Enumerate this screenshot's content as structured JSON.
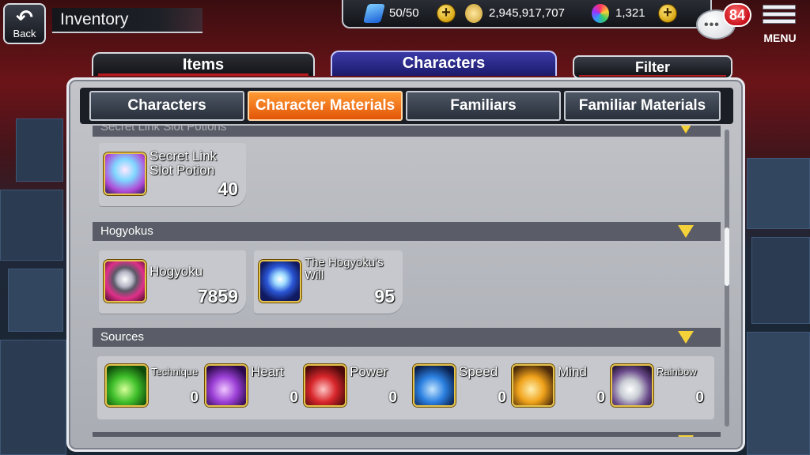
{
  "header": {
    "back_label": "Back",
    "title": "Inventory"
  },
  "resources": {
    "stamina": "50/50",
    "coins": "2,945,917,707",
    "orbs": "1,321"
  },
  "notifications": {
    "count": "84"
  },
  "menu": {
    "label": "MENU"
  },
  "top_tabs": [
    {
      "label": "Items"
    },
    {
      "label": "Characters",
      "active": true
    }
  ],
  "filter": {
    "label": "Filter"
  },
  "sub_tabs": [
    {
      "label": "Characters"
    },
    {
      "label": "Character Materials",
      "active": true
    },
    {
      "label": "Familiars"
    },
    {
      "label": "Familiar Materials"
    }
  ],
  "sections": {
    "potions": {
      "header_partial": "Secret Link Slot Potions",
      "items": [
        {
          "name_line1": "Secret Link",
          "name_line2": "Slot Potion",
          "qty": "40",
          "icon": "potion-icon"
        }
      ]
    },
    "hogyokus": {
      "header": "Hogyokus",
      "items": [
        {
          "name": "Hogyoku",
          "qty": "7859",
          "icon": "hogyoku-icon"
        },
        {
          "name_line1": "The Hogyoku's",
          "name_line2": "Will",
          "qty": "95",
          "icon": "hogyoku-will-icon"
        }
      ]
    },
    "sources": {
      "header": "Sources",
      "items": [
        {
          "name": "Technique",
          "qty": "0",
          "color": "#3fbf2a"
        },
        {
          "name": "Heart",
          "qty": "0",
          "color": "#9b3fd6"
        },
        {
          "name": "Power",
          "qty": "0",
          "color": "#d8262b"
        },
        {
          "name": "Speed",
          "qty": "0",
          "color": "#2a7fe0"
        },
        {
          "name": "Mind",
          "qty": "0",
          "color": "#f0a21a"
        },
        {
          "name": "Rainbow",
          "qty": "0",
          "color": "#c9cdd4"
        }
      ]
    }
  },
  "colors": {
    "active_subtab": "#ff7a1a",
    "active_tab": "#2d2c94",
    "section_header": "#5a5d67",
    "expand_triangle": "#f6d23a"
  }
}
